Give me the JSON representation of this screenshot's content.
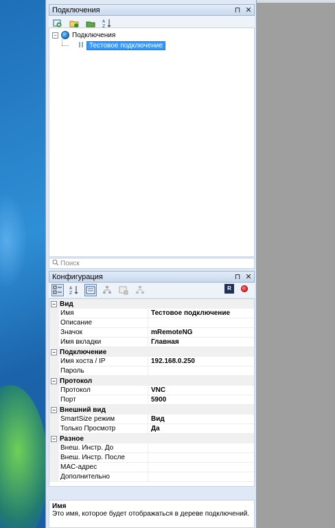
{
  "connections_panel": {
    "title": "Подключения",
    "pin_glyph": "⊓",
    "close_glyph": "✕",
    "toolbar_icons": [
      "new-connection-icon",
      "new-folder-icon",
      "view-icon",
      "sort-az-icon"
    ],
    "sort_glyph": "A↓Z",
    "tree": {
      "root_label": "Подключения",
      "root_expander": "−",
      "child_label": "Тестовое подключение"
    },
    "search_placeholder": "Поиск"
  },
  "config_panel": {
    "title": "Конфигурация",
    "pin_glyph": "⊓",
    "close_glyph": "✕",
    "toolbar_icons": [
      "categorized-icon",
      "sort-az-icon",
      "properties-icon",
      "inheritance-icon",
      "default-props-icon",
      "default-inheritance-icon"
    ],
    "right_badge": "R",
    "sort_glyph": "A↓Z",
    "categories": [
      {
        "name": "Вид",
        "rows": [
          {
            "key": "Имя",
            "value": "Тестовое подключение"
          },
          {
            "key": "Описание",
            "value": ""
          },
          {
            "key": "Значок",
            "value": "mRemoteNG"
          },
          {
            "key": "Имя вкладки",
            "value": "Главная"
          }
        ]
      },
      {
        "name": "Подключение",
        "rows": [
          {
            "key": "Имя хоста / IP",
            "value": "192.168.0.250"
          },
          {
            "key": "Пароль",
            "value": ""
          }
        ]
      },
      {
        "name": "Протокол",
        "rows": [
          {
            "key": "Протокол",
            "value": "VNC"
          },
          {
            "key": "Порт",
            "value": "5900"
          }
        ]
      },
      {
        "name": "Внешний вид",
        "rows": [
          {
            "key": "SmartSize режим",
            "value": "Вид"
          },
          {
            "key": "Только Просмотр",
            "value": "Да"
          }
        ]
      },
      {
        "name": "Разное",
        "rows": [
          {
            "key": "Внеш. Инстр. До",
            "value": ""
          },
          {
            "key": "Внеш. Инстр. После",
            "value": ""
          },
          {
            "key": "MAC-адрес",
            "value": ""
          },
          {
            "key": "Дополнительно",
            "value": ""
          }
        ]
      }
    ],
    "collapse_glyph": "−",
    "description": {
      "title": "Имя",
      "text": "Это имя, которое будет отображаться в дереве подключений."
    }
  }
}
